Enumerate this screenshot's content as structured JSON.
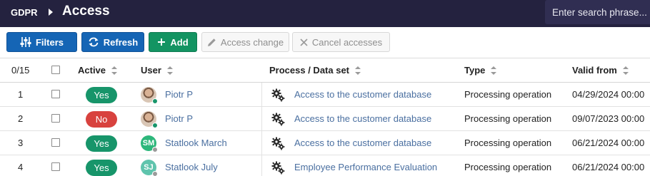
{
  "header": {
    "app_name": "GDPR",
    "page_title": "Access",
    "search_placeholder": "Enter search phrase..."
  },
  "toolbar": {
    "filters_label": "Filters",
    "refresh_label": "Refresh",
    "add_label": "Add",
    "access_change_label": "Access change",
    "cancel_accesses_label": "Cancel accesses"
  },
  "table": {
    "selection_count": "0/15",
    "columns": {
      "active": "Active",
      "user": "User",
      "process": "Process / Data set",
      "type": "Type",
      "valid_from": "Valid from"
    },
    "rows": [
      {
        "num": "1",
        "active": "Yes",
        "active_state": "yes",
        "user": "Piotr P",
        "avatar": "photo",
        "user_status_color": "#17956a",
        "process": "Access to the customer database",
        "type": "Processing operation",
        "valid_from": "04/29/2024 00:00"
      },
      {
        "num": "2",
        "active": "No",
        "active_state": "no",
        "user": "Piotr P",
        "avatar": "photo",
        "user_status_color": "#17956a",
        "process": "Access to the customer database",
        "type": "Processing operation",
        "valid_from": "09/07/2023 00:00"
      },
      {
        "num": "3",
        "active": "Yes",
        "active_state": "yes",
        "user": "Statlook March",
        "avatar": "initials",
        "initials": "SM",
        "avatar_color": "#2db77b",
        "user_status_color": "#9a9a9a",
        "process": "Access to the customer database",
        "type": "Processing operation",
        "valid_from": "06/21/2024 00:00"
      },
      {
        "num": "4",
        "active": "Yes",
        "active_state": "yes",
        "user": "Statlook July",
        "avatar": "initials",
        "initials": "SJ",
        "avatar_color": "#5fc4ad",
        "user_status_color": "#9a9a9a",
        "process": "Employee Performance Evaluation",
        "type": "Processing operation",
        "valid_from": "06/21/2024 00:00"
      }
    ]
  },
  "colors": {
    "header_bg": "#24223f",
    "primary": "#1565b5",
    "success": "#139462",
    "danger": "#d8423e",
    "link": "#4a6fa0"
  }
}
